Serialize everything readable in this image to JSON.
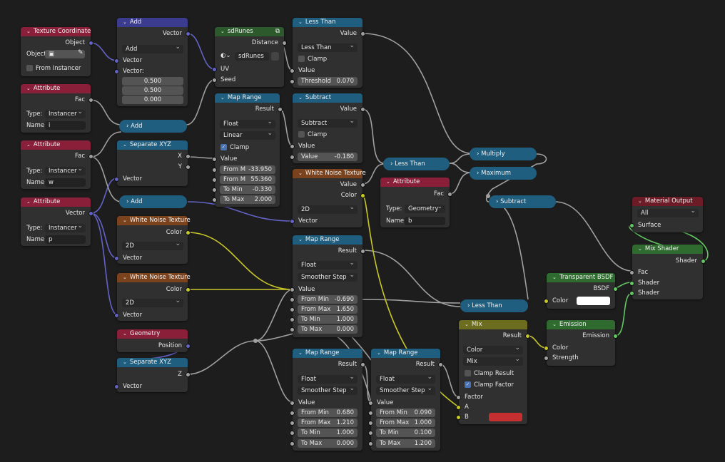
{
  "n_texcoord": {
    "title": "Texture Coordinate",
    "out": "Object",
    "obj": "Object:",
    "inst": "From Instancer"
  },
  "n_add1": {
    "title": "Add",
    "out": "Vector",
    "mode": "Add",
    "in1": "Vector",
    "in2": "Vector:",
    "x": "0.500",
    "y": "0.500",
    "z": "0.000"
  },
  "n_sdr": {
    "title": "sdRunes",
    "out": "Distance",
    "dd": "sdRunes",
    "in1": "UV",
    "in2": "Seed"
  },
  "n_lt1": {
    "title": "Less Than",
    "out": "Value",
    "mode": "Less Than",
    "clamp": "Clamp",
    "in1": "Value",
    "thr": "Threshold",
    "thr_v": "0.070"
  },
  "n_attr_i": {
    "title": "Attribute",
    "out": "Fac",
    "type_l": "Type:",
    "type_v": "Instancer",
    "name_l": "Name:",
    "name_v": "i"
  },
  "n_attr_w": {
    "title": "Attribute",
    "out": "Fac",
    "type_l": "Type:",
    "type_v": "Instancer",
    "name_l": "Name:",
    "name_v": "w"
  },
  "n_attr_p": {
    "title": "Attribute",
    "out": "Vector",
    "type_l": "Type:",
    "type_v": "Instancer",
    "name_l": "Name:",
    "name_v": "p"
  },
  "n_add2": {
    "title": "Add"
  },
  "n_add3": {
    "title": "Add"
  },
  "n_mr1": {
    "title": "Map Range",
    "out": "Result",
    "dtype": "Float",
    "interp": "Linear",
    "clamp": "Clamp",
    "in": "Value",
    "f1": "From M",
    "f1v": "-33.950",
    "f2": "From M",
    "f2v": "55.360",
    "f3": "To Min",
    "f3v": "-0.330",
    "f4": "To Max",
    "f4v": "2.000"
  },
  "n_sub1": {
    "title": "Subtract",
    "out": "Value",
    "mode": "Subtract",
    "clamp": "Clamp",
    "in": "Value",
    "vl": "Value",
    "vv": "-0.180"
  },
  "n_sep1": {
    "title": "Separate XYZ",
    "x": "X",
    "y": "Y",
    "in": "Vector"
  },
  "n_wn1": {
    "title": "White Noise Texture",
    "out1": "Value",
    "out2": "Color",
    "dim": "2D",
    "in": "Vector"
  },
  "n_lt2": {
    "title": "Less Than"
  },
  "n_mult": {
    "title": "Multiply"
  },
  "n_max": {
    "title": "Maximum"
  },
  "n_attr_b": {
    "title": "Attribute",
    "out": "Fac",
    "type_l": "Type:",
    "type_v": "Geometry",
    "name_l": "Name:",
    "name_v": "b"
  },
  "n_sub2": {
    "title": "Subtract"
  },
  "n_matout": {
    "title": "Material Output",
    "target": "All",
    "in": "Surface"
  },
  "n_wn2": {
    "title": "White Noise Texture",
    "out": "Color",
    "dim": "2D",
    "in": "Vector"
  },
  "n_wn3": {
    "title": "White Noise Texture",
    "out": "Color",
    "dim": "2D",
    "in": "Vector"
  },
  "n_mr2": {
    "title": "Map Range",
    "out": "Result",
    "dtype": "Float",
    "interp": "Smoother Step",
    "in": "Value",
    "f1": "From Min",
    "f1v": "-0.690",
    "f2": "From Max",
    "f2v": "1.650",
    "f3": "To Min",
    "f3v": "1.000",
    "f4": "To Max",
    "f4v": "0.000"
  },
  "n_mixsh": {
    "title": "Mix Shader",
    "out": "Shader",
    "in1": "Fac",
    "in2": "Shader",
    "in3": "Shader"
  },
  "n_transp": {
    "title": "Transparent BSDF",
    "out": "BSDF",
    "in": "Color",
    "color": "#ffffff"
  },
  "n_lt3": {
    "title": "Less Than"
  },
  "n_geo": {
    "title": "Geometry",
    "out": "Position"
  },
  "n_sep2": {
    "title": "Separate XYZ",
    "z": "Z",
    "in": "Vector"
  },
  "n_mix": {
    "title": "Mix",
    "out": "Result",
    "dtype": "Color",
    "blend": "Mix",
    "cr": "Clamp Result",
    "cf": "Clamp Factor",
    "in1": "Factor",
    "in2": "A",
    "in3": "B",
    "b_color": "#c62f2f"
  },
  "n_emis": {
    "title": "Emission",
    "out": "Emission",
    "in1": "Color",
    "in2": "Strength"
  },
  "n_mr3": {
    "title": "Map Range",
    "out": "Result",
    "dtype": "Float",
    "interp": "Smoother Step",
    "in": "Value",
    "f1": "From Min",
    "f1v": "0.680",
    "f2": "From Max",
    "f2v": "1.210",
    "f3": "To Min",
    "f3v": "1.000",
    "f4": "To Max",
    "f4v": "0.000"
  },
  "n_mr4": {
    "title": "Map Range",
    "out": "Result",
    "dtype": "Float",
    "interp": "Smoother Step",
    "in": "Value",
    "f1": "From Min",
    "f1v": "0.090",
    "f2": "From Max",
    "f2v": "1.000",
    "f3": "To Min",
    "f3v": "0.100",
    "f4": "To Max",
    "f4v": "1.200"
  },
  "colors": {
    "wire_grey": "#a0a0a0",
    "wire_vec": "#6363c7",
    "wire_yellow": "#c7c729",
    "wire_green": "#63c763"
  }
}
